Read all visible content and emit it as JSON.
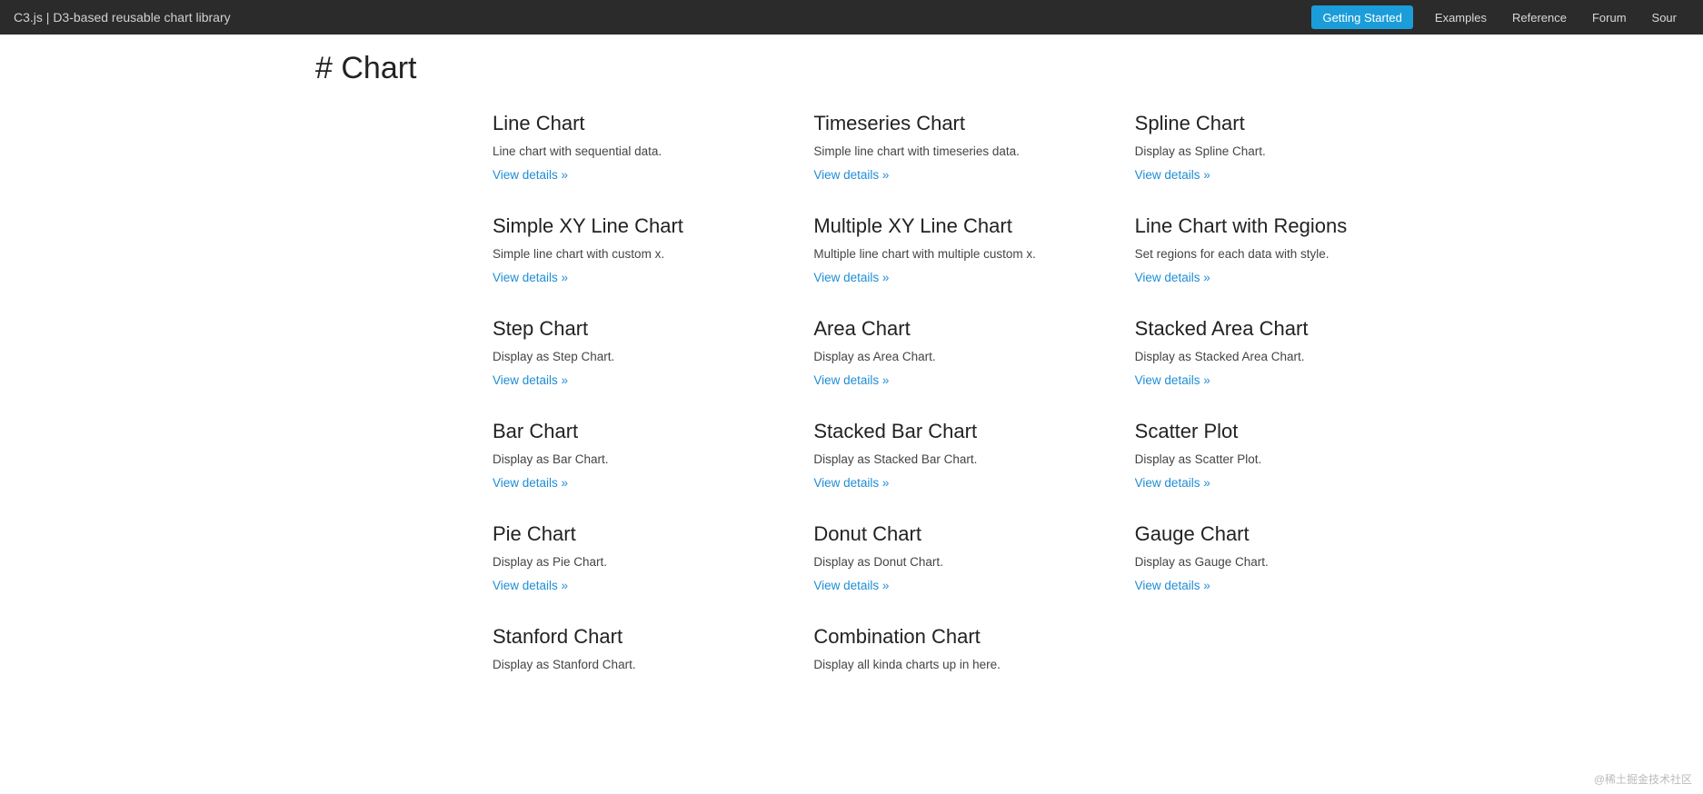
{
  "navbar": {
    "brand": "C3.js | D3-based reusable chart library",
    "links": {
      "getting_started": "Getting Started",
      "examples": "Examples",
      "reference": "Reference",
      "forum": "Forum",
      "source": "Sour"
    }
  },
  "page": {
    "title": "# Chart"
  },
  "cards": [
    {
      "title": "Line Chart",
      "desc": "Line chart with sequential data.",
      "link": "View details »"
    },
    {
      "title": "Timeseries Chart",
      "desc": "Simple line chart with timeseries data.",
      "link": "View details »"
    },
    {
      "title": "Spline Chart",
      "desc": "Display as Spline Chart.",
      "link": "View details »"
    },
    {
      "title": "Simple XY Line Chart",
      "desc": "Simple line chart with custom x.",
      "link": "View details »"
    },
    {
      "title": "Multiple XY Line Chart",
      "desc": "Multiple line chart with multiple custom x.",
      "link": "View details »"
    },
    {
      "title": "Line Chart with Regions",
      "desc": "Set regions for each data with style.",
      "link": "View details »"
    },
    {
      "title": "Step Chart",
      "desc": "Display as Step Chart.",
      "link": "View details »"
    },
    {
      "title": "Area Chart",
      "desc": "Display as Area Chart.",
      "link": "View details »"
    },
    {
      "title": "Stacked Area Chart",
      "desc": "Display as Stacked Area Chart.",
      "link": "View details »"
    },
    {
      "title": "Bar Chart",
      "desc": "Display as Bar Chart.",
      "link": "View details »"
    },
    {
      "title": "Stacked Bar Chart",
      "desc": "Display as Stacked Bar Chart.",
      "link": "View details »"
    },
    {
      "title": "Scatter Plot",
      "desc": "Display as Scatter Plot.",
      "link": "View details »"
    },
    {
      "title": "Pie Chart",
      "desc": "Display as Pie Chart.",
      "link": "View details »"
    },
    {
      "title": "Donut Chart",
      "desc": "Display as Donut Chart.",
      "link": "View details »"
    },
    {
      "title": "Gauge Chart",
      "desc": "Display as Gauge Chart.",
      "link": "View details »"
    },
    {
      "title": "Stanford Chart",
      "desc": "Display as Stanford Chart.",
      "link": ""
    },
    {
      "title": "Combination Chart",
      "desc": "Display all kinda charts up in here.",
      "link": ""
    }
  ],
  "watermark": "@稀土掘金技术社区"
}
